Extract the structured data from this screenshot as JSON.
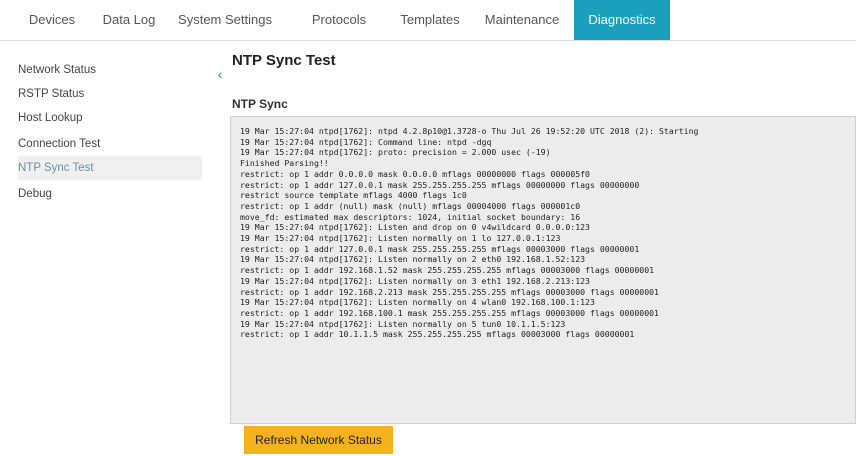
{
  "nav": {
    "tabs": [
      {
        "label": "Devices"
      },
      {
        "label": "Data Log"
      },
      {
        "label": "System Settings"
      },
      {
        "label": "Protocols"
      },
      {
        "label": "Templates"
      },
      {
        "label": "Maintenance"
      },
      {
        "label": "Diagnostics",
        "active": true
      }
    ]
  },
  "sidebar": {
    "items": [
      {
        "label": "Network Status"
      },
      {
        "label": "RSTP Status"
      },
      {
        "label": "Host Lookup"
      },
      {
        "label": "Connection Test"
      },
      {
        "label": "NTP Sync Test",
        "active": true
      },
      {
        "label": "Debug"
      }
    ],
    "collapse_glyph": "‹"
  },
  "main": {
    "title": "NTP Sync Test",
    "section_title": "NTP Sync",
    "log_lines": [
      "19 Mar 15:27:04 ntpd[1762]: ntpd 4.2.8p10@1.3728-o Thu Jul 26 19:52:20 UTC 2018 (2): Starting",
      "19 Mar 15:27:04 ntpd[1762]: Command line: ntpd -dgq",
      "19 Mar 15:27:04 ntpd[1762]: proto: precision = 2.000 usec (-19)",
      "Finished Parsing!!",
      "restrict: op 1 addr 0.0.0.0 mask 0.0.0.0 mflags 00000000 flags 000005f0",
      "restrict: op 1 addr 127.0.0.1 mask 255.255.255.255 mflags 00000000 flags 00000000",
      "restrict source template mflags 4000 flags 1c0",
      "restrict: op 1 addr (null) mask (null) mflags 00004000 flags 000001c0",
      "move_fd: estimated max descriptors: 1024, initial socket boundary: 16",
      "19 Mar 15:27:04 ntpd[1762]: Listen and drop on 0 v4wildcard 0.0.0.0:123",
      "19 Mar 15:27:04 ntpd[1762]: Listen normally on 1 lo 127.0.0.1:123",
      "restrict: op 1 addr 127.0.0.1 mask 255.255.255.255 mflags 00003000 flags 00000001",
      "19 Mar 15:27:04 ntpd[1762]: Listen normally on 2 eth0 192.168.1.52:123",
      "restrict: op 1 addr 192.168.1.52 mask 255.255.255.255 mflags 00003000 flags 00000001",
      "19 Mar 15:27:04 ntpd[1762]: Listen normally on 3 eth1 192.168.2.213:123",
      "restrict: op 1 addr 192.168.2.213 mask 255.255.255.255 mflags 00003000 flags 00000001",
      "19 Mar 15:27:04 ntpd[1762]: Listen normally on 4 wlan0 192.168.100.1:123",
      "restrict: op 1 addr 192.168.100.1 mask 255.255.255.255 mflags 00003000 flags 00000001",
      "19 Mar 15:27:04 ntpd[1762]: Listen normally on 5 tun0 10.1.1.5:123",
      "restrict: op 1 addr 10.1.1.5 mask 255.255.255.255 mflags 00003000 flags 00000001"
    ],
    "refresh_button": "Refresh Network Status"
  },
  "colors": {
    "accent": "#1a9fbd",
    "button": "#f5b11e",
    "log_background": "#ececec"
  }
}
